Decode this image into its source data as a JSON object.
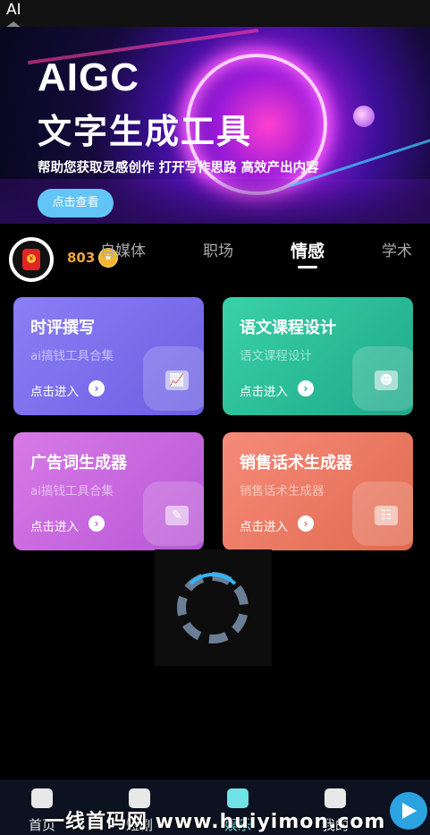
{
  "status_bar": {
    "label": "AI"
  },
  "banner": {
    "title_line1": "AIGC",
    "title_line2": "文字生成工具",
    "subtitle": "帮助您获取灵感创作 打开写作思路 高效产出内容",
    "button": "点击查看"
  },
  "user": {
    "score": "803"
  },
  "tabs": [
    {
      "label": "自媒体"
    },
    {
      "label": "职场"
    },
    {
      "label": "情感",
      "active": true
    },
    {
      "label": "学术"
    }
  ],
  "cards": [
    {
      "title": "时评撰写",
      "desc": "ai搞钱工具合集",
      "enter": "点击进入",
      "icon": "chart-icon"
    },
    {
      "title": "语文课程设计",
      "desc": "语文课程设计",
      "enter": "点击进入",
      "icon": "head-icon"
    },
    {
      "title": "广告词生成器",
      "desc": "ai搞钱工具合集",
      "enter": "点击进入",
      "icon": "edit-icon"
    },
    {
      "title": "销售话术生成器",
      "desc": "销售话术生成器",
      "enter": "点击进入",
      "icon": "speech-icon"
    }
  ],
  "bottom_nav": [
    {
      "label": "首页",
      "icon": "home-icon"
    },
    {
      "label": "短剧",
      "icon": "clapper-icon"
    },
    {
      "label": "娱乐",
      "icon": "document-icon",
      "active": true
    },
    {
      "label": "我的",
      "icon": "robot-icon"
    }
  ],
  "watermark": "一线首码网 www.huiyimon.com",
  "colors": {
    "accent": "#6fe3e6",
    "score": "#f0a63d",
    "banner_button": "#62c4f7"
  }
}
